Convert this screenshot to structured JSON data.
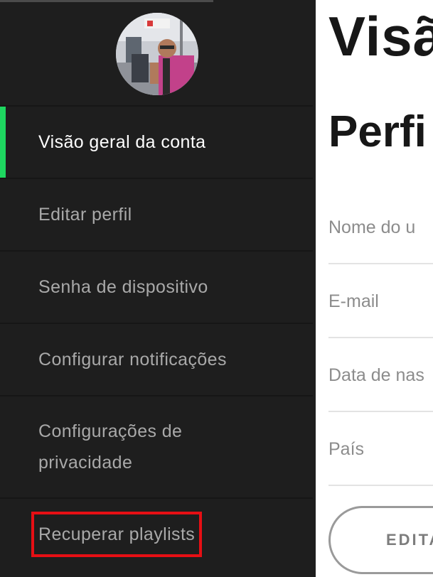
{
  "sidebar": {
    "items": [
      {
        "label": "Visão geral da conta"
      },
      {
        "label": "Editar perfil"
      },
      {
        "label": "Senha de dispositivo"
      },
      {
        "label": "Configurar notificações"
      },
      {
        "label": "Configurações de privacidade"
      },
      {
        "label": "Recuperar playlists"
      }
    ],
    "active_index": 0,
    "highlighted_index": 5,
    "accent_color": "#1ed760",
    "highlight_color": "#e60f14"
  },
  "main": {
    "title": "Visã",
    "subtitle": "Perfi",
    "fields": [
      {
        "label": "Nome do u"
      },
      {
        "label": "E-mail"
      },
      {
        "label": "Data de nas"
      },
      {
        "label": "País"
      }
    ],
    "edit_button": "EDITA"
  }
}
